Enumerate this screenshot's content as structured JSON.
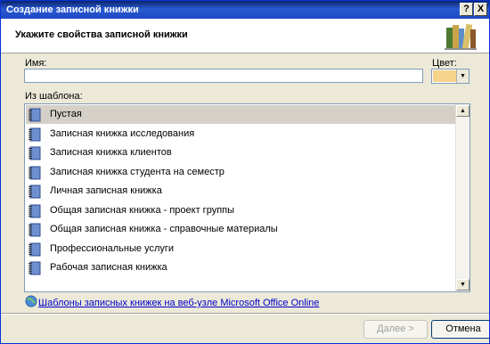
{
  "window": {
    "title": "Создание записной книжки",
    "help_label": "?",
    "close_label": "X"
  },
  "header": {
    "title": "Укажите свойства записной книжки"
  },
  "form": {
    "name_label": "Имя:",
    "name_value": "",
    "color_label": "Цвет:",
    "color_value": "#F6D38A",
    "template_label": "Из шаблона:"
  },
  "templates": [
    {
      "label": "Пустая",
      "selected": true
    },
    {
      "label": "Записная книжка исследования",
      "selected": false
    },
    {
      "label": "Записная книжка клиентов",
      "selected": false
    },
    {
      "label": "Записная книжка студента на семестр",
      "selected": false
    },
    {
      "label": "Личная записная книжка",
      "selected": false
    },
    {
      "label": "Общая записная книжка - проект группы",
      "selected": false
    },
    {
      "label": "Общая записная книжка - справочные материалы",
      "selected": false
    },
    {
      "label": "Профессиональные услуги",
      "selected": false
    },
    {
      "label": "Рабочая записная книжка",
      "selected": false
    }
  ],
  "online_link": "Шаблоны записных книжек на веб-узле Microsoft Office Online",
  "buttons": {
    "next_label": "Далее >",
    "cancel_label": "Отмена"
  },
  "icons": {
    "notebook": "notebook-icon",
    "globe": "globe-link-icon",
    "books": "books-header-icon"
  }
}
